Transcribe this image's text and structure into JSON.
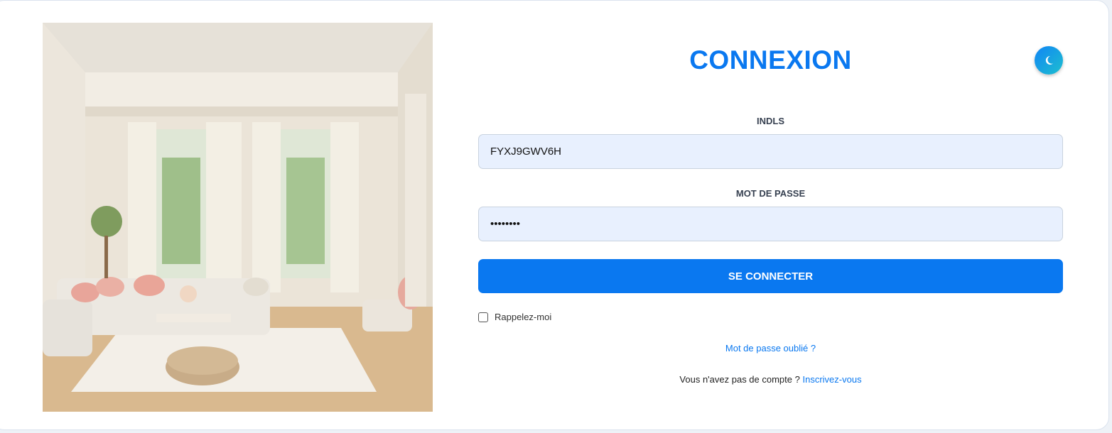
{
  "login": {
    "title": "CONNEXION",
    "id_label": "INDLS",
    "id_value": "FYXJ9GWV6H",
    "password_label": "MOT DE PASSE",
    "password_value": "password",
    "submit_label": "SE CONNECTER",
    "remember_label": "Rappelez-moi",
    "remember_checked": false,
    "forgot_link": "Mot de passe oublié ?",
    "signup_prompt": "Vous n'avez pas de compte ?",
    "signup_link": "Inscrivez-vous"
  },
  "icons": {
    "theme_toggle": "moon-icon"
  },
  "colors": {
    "accent": "#0a78f0",
    "field_bg": "#e8f0fe",
    "toggle_gradient_start": "#1185f5",
    "toggle_gradient_end": "#1dbfcf"
  }
}
